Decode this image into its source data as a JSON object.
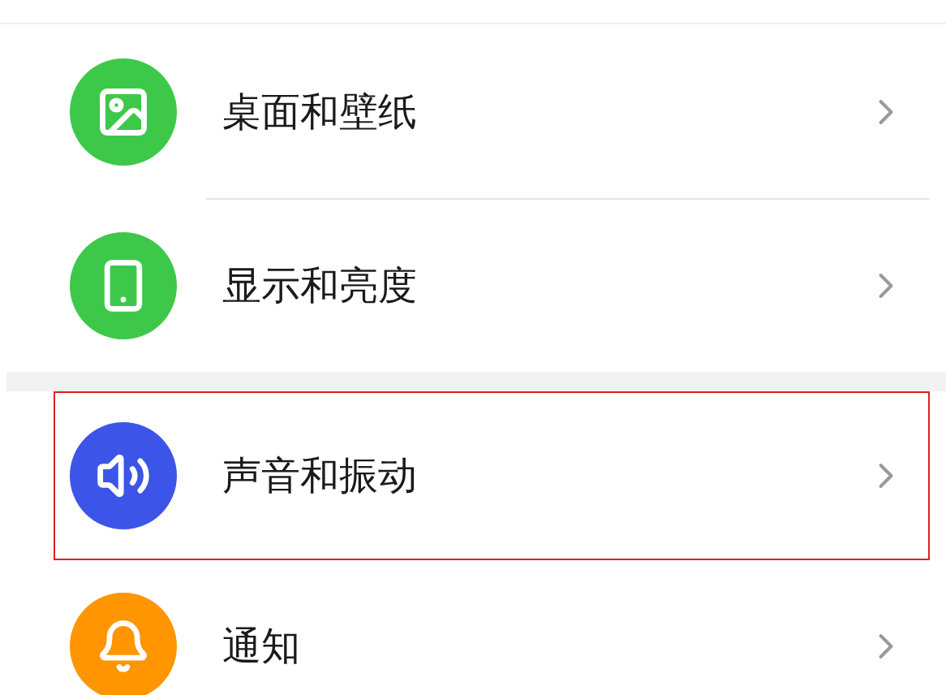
{
  "groups": [
    {
      "items": [
        {
          "label": "桌面和壁纸",
          "kind": "wallpaper",
          "color": "#3ec84a",
          "highlighted": false
        },
        {
          "label": "显示和亮度",
          "kind": "display",
          "color": "#3ec84a",
          "highlighted": false
        }
      ]
    },
    {
      "items": [
        {
          "label": "声音和振动",
          "kind": "sound",
          "color": "#3c55e8",
          "highlighted": true
        },
        {
          "label": "通知",
          "kind": "notification",
          "color": "#ff9500",
          "highlighted": false
        }
      ]
    }
  ]
}
